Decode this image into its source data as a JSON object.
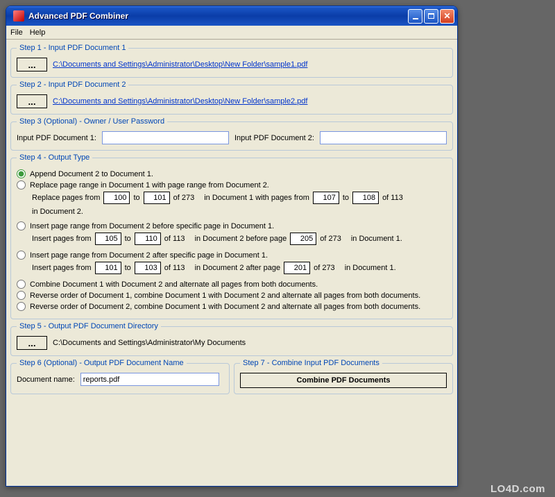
{
  "titlebar": {
    "title": "Advanced PDF Combiner"
  },
  "menu": {
    "file": "File",
    "help": "Help"
  },
  "step1": {
    "legend": "Step 1 - Input PDF Document 1",
    "browse": "...",
    "path": "C:\\Documents and Settings\\Administrator\\Desktop\\New Folder\\sample1.pdf"
  },
  "step2": {
    "legend": "Step 2 - Input PDF Document 2",
    "browse": "...",
    "path": "C:\\Documents and Settings\\Administrator\\Desktop\\New Folder\\sample2.pdf"
  },
  "step3": {
    "legend": "Step 3 (Optional) - Owner / User Password",
    "label1": "Input PDF Document 1:",
    "label2": "Input PDF Document 2:",
    "value1": "",
    "value2": ""
  },
  "step4": {
    "legend": "Step 4 - Output Type",
    "opt1": "Append Document 2 to Document 1.",
    "opt2": "Replace page range in Document 1 with page range from Document 2.",
    "opt2detail": {
      "prefix": "Replace pages from",
      "v1": "100",
      "to": "to",
      "v2": "101",
      "of1a": "of 273",
      "mid1": "in Document 1 with pages from",
      "v3": "107",
      "v4": "108",
      "of2a": "of 113",
      "tail": "in Document 2."
    },
    "opt3": "Insert page range from Document 2 before specific page in Document 1.",
    "opt3detail": {
      "prefix": "Insert pages from",
      "v1": "105",
      "to": "to",
      "v2": "110",
      "of1": "of 113",
      "mid": "in Document 2 before page",
      "v3": "205",
      "of2": "of 273",
      "tail": "in Document 1."
    },
    "opt4": "Insert page range from Document 2 after specific page in Document 1.",
    "opt4detail": {
      "prefix": "Insert pages from",
      "v1": "101",
      "to": "to",
      "v2": "103",
      "of1": "of 113",
      "mid": "in Document 2 after page",
      "v3": "201",
      "of2": "of 273",
      "tail": "in Document 1."
    },
    "opt5": "Combine Document 1 with Document 2 and alternate all pages from both documents.",
    "opt6": "Reverse order of Document 1, combine Document 1 with Document 2 and alternate all pages from both documents.",
    "opt7": "Reverse order of Document 2, combine Document 1 with Document 2 and alternate all pages from both documents."
  },
  "step5": {
    "legend": "Step 5 - Output PDF Document Directory",
    "browse": "...",
    "path": "C:\\Documents and Settings\\Administrator\\My Documents"
  },
  "step6": {
    "legend": "Step 6 (Optional) - Output PDF Document Name",
    "label": "Document name:",
    "value": "reports.pdf"
  },
  "step7": {
    "legend": "Step 7 - Combine Input PDF Documents",
    "button": "Combine PDF Documents"
  },
  "watermark": "LO4D.com"
}
